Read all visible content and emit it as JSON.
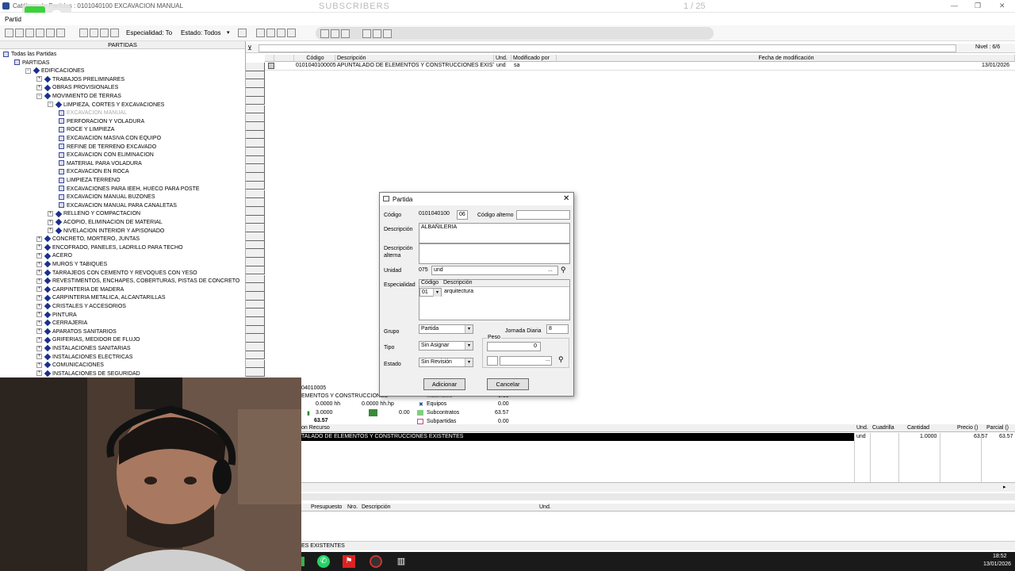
{
  "window": {
    "title": "Catálogo de Partidas : 0101040100  EXCAVACION MANUAL",
    "overlay_text": "SUBSCRIBERS",
    "overlay_count": "1 / 25"
  },
  "menu": {
    "first": "Partid"
  },
  "toolbar": {
    "especialidad_label": "Especialidad: To",
    "estado_label": "Estado: Todos"
  },
  "tree": {
    "header": "PARTIDAS",
    "items": [
      {
        "label": "Todas las Partidas"
      },
      {
        "label": "PARTIDAS"
      },
      {
        "label": "EDIFICACIONES"
      },
      {
        "label": "TRABAJOS PRELIMINARES"
      },
      {
        "label": "OBRAS PROVISIONALES"
      },
      {
        "label": "MOVIMIENTO DE TERRAS"
      },
      {
        "label": "LIMPIEZA, CORTES Y EXCAVACIONES"
      },
      {
        "label": "EXCAVACION MANUAL"
      },
      {
        "label": "PERFORACION Y VOLADURA"
      },
      {
        "label": "ROCE Y LIMPIEZA"
      },
      {
        "label": "EXCAVACION MASIVA CON EQUIPO"
      },
      {
        "label": "REFINE DE TERRENO EXCAVADO"
      },
      {
        "label": "EXCAVACION CON ELIMINACION"
      },
      {
        "label": "MATERIAL PARA VOLADURA"
      },
      {
        "label": "EXCAVACION EN ROCA"
      },
      {
        "label": "LIMPIEZA TERRENO"
      },
      {
        "label": "EXCAVACIONES PARA IEEH,  HUECO PARA POSTE"
      },
      {
        "label": "EXCAVACION MANUAL BUZONES"
      },
      {
        "label": "EXCAVACION MANUAL PARA CANALETAS"
      },
      {
        "label": "RELLENO Y COMPACTACION"
      },
      {
        "label": "ACOPIO, ELIMINACION DE MATERIAL"
      },
      {
        "label": "NIVELACION INTERIOR Y APISONADO"
      },
      {
        "label": "CONCRETO, MORTERO, JUNTAS"
      },
      {
        "label": "ENCOFRADO, PANELES, LADRILLO PARA TECHO"
      },
      {
        "label": "ACERO"
      },
      {
        "label": "MUROS Y TABIQUES"
      },
      {
        "label": "TARRAJEOS CON CEMENTO Y REVOQUES CON YESO"
      },
      {
        "label": "REVESTIMENTOS,  ENCHAPES, COBERTURAS, PISTAS DE CONCRETO"
      },
      {
        "label": "CARPINTERIA DE MADERA"
      },
      {
        "label": "CARPINTERIA METALICA, ALCANTARILLAS"
      },
      {
        "label": "CRISTALES Y ACCESORIOS"
      },
      {
        "label": "PINTURA"
      },
      {
        "label": "CERRAJERIA"
      },
      {
        "label": "APARATOS SANITARIOS"
      },
      {
        "label": "GRIFERIAS, MEDIDOR DE FLUJO"
      },
      {
        "label": "INSTALACIONES SANITARIAS"
      },
      {
        "label": "INSTALACIONES ELECTRICAS"
      },
      {
        "label": "COMUNICACIONES"
      },
      {
        "label": "INSTALACIONES DE SEGURIDAD"
      }
    ]
  },
  "grid": {
    "nivel": "Nivel : 6/6",
    "columns": [
      "Código",
      "Descripción",
      "Und.",
      "Modificado por",
      "Fecha de modificación"
    ],
    "row": {
      "codigo": "0101040100005",
      "descripcion": "APUNTALADO DE ELEMENTOS Y CONSTRUCCIONES EXISTENTES",
      "und": "und",
      "modificado": "sa",
      "fecha": "13/01/2026"
    }
  },
  "dialog": {
    "title": "Partida",
    "codigo_label": "Código",
    "codigo_value": "0101040100",
    "codigo_suffix": "06",
    "codigo_alterno_label": "Código alterno",
    "descripcion_label": "Descripción",
    "descripcion_value": "ALBAÑILERIA",
    "descripcion_alterna_label_1": "Descripción",
    "descripcion_alterna_label_2": "alterna",
    "unidad_label": "Unidad",
    "unidad_code": "075",
    "unidad_value": "und",
    "especialidad_label": "Especialidad",
    "esp_col_codigo": "Código",
    "esp_col_descripcion": "Descripción",
    "esp_codigo": "01",
    "esp_descripcion": "arquitectura",
    "grupo_label": "Grupo",
    "grupo_value": "Partida",
    "jornada_label": "Jornada Diaria",
    "jornada_value": "8",
    "tipo_label": "Tipo",
    "tipo_value": "Sin Asignar",
    "peso_label": "Peso",
    "peso_value": "0",
    "estado_label": "Estado",
    "estado_value": "Sin Revisión",
    "adicionar": "Adicionar",
    "cancelar": "Cancelar"
  },
  "lower": {
    "code": "04010005",
    "desc": "EMENTOS Y CONSTRUCCIONES",
    "materiales": "Materiales",
    "materiales_val": "0.00",
    "hh": "0.0000 hh",
    "hhhp": "0.0000 hh.hp",
    "equipos": "Equipos",
    "equipos_val": "0.00",
    "rend": "3.0000",
    "rend_val": "0.00",
    "subcontratos": "Subcontratos",
    "subcontratos_val": "63.57",
    "total": "63.57",
    "subpartidas": "Subpartidas",
    "subpartidas_val": "0.00",
    "recurso_header": "on Recurso",
    "res_cols": [
      "Und.",
      "Cuadrilla",
      "Cantidad",
      "Precio ()",
      "Parcial ()"
    ],
    "res_row": {
      "desc": "TALADO DE ELEMENTOS Y CONSTRUCCIONES EXISTENTES",
      "und": "und",
      "cantidad": "1.0000",
      "precio": "63.57",
      "parcial": "63.57"
    },
    "bottom_cols": [
      "Presupuesto",
      "Nro.",
      "Descripción",
      "Und."
    ],
    "status": "ES EXISTENTES"
  },
  "taskbar": {
    "time": "18:52",
    "date": "13/01/2026"
  },
  "logo": {
    "text": "2"
  }
}
